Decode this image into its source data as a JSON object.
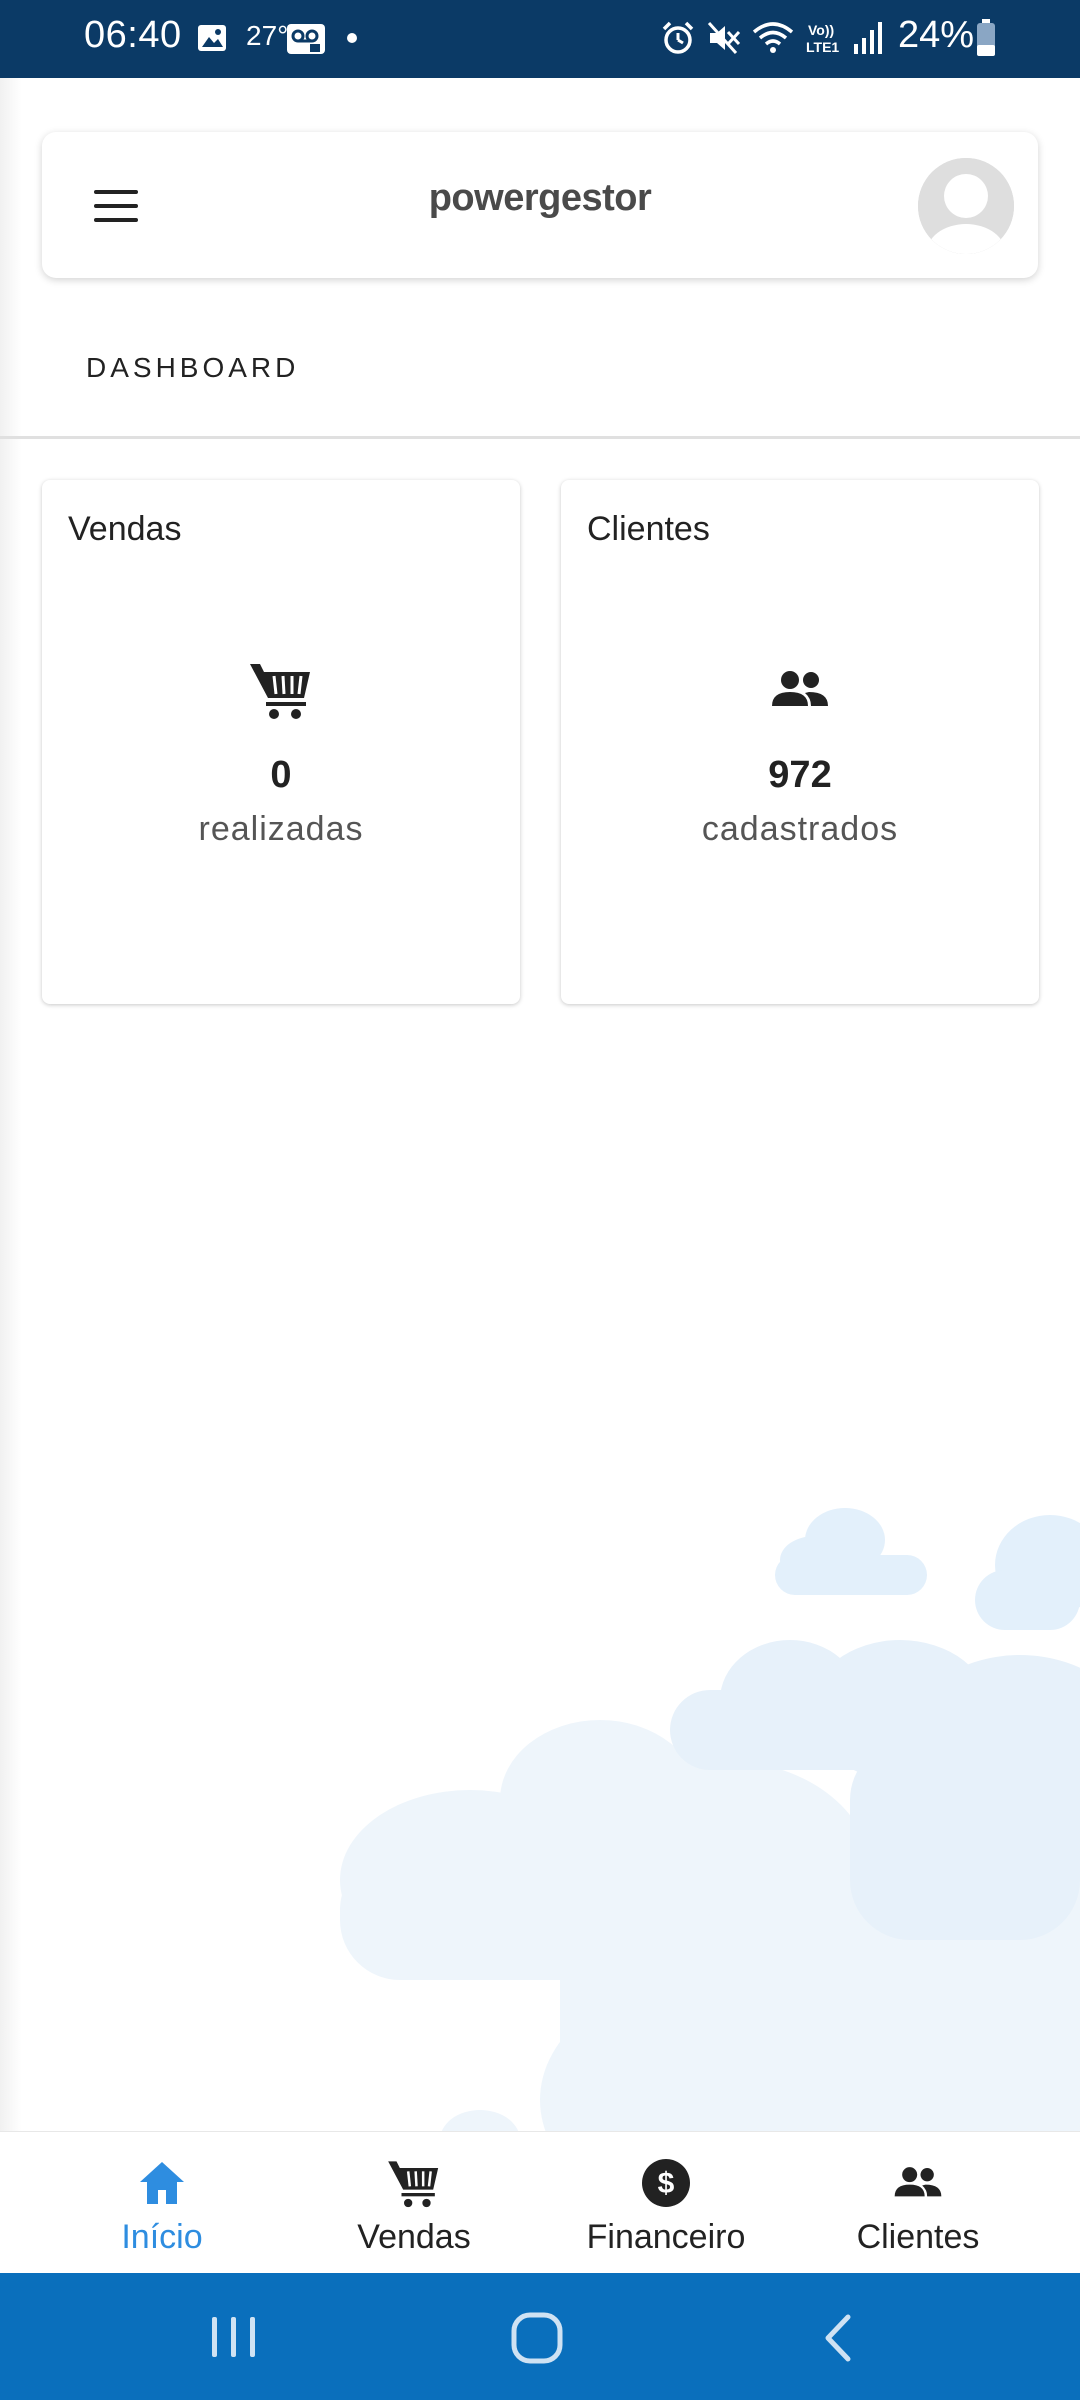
{
  "status_bar": {
    "time": "06:40",
    "temperature": "27°",
    "battery": "24%",
    "icons": [
      "image-icon",
      "voicemail-icon",
      "dot-icon",
      "alarm-icon",
      "mute-icon",
      "wifi-icon",
      "volte-icon",
      "signal-icon",
      "battery-icon"
    ]
  },
  "header": {
    "brand": "powergestor",
    "menu_icon": "hamburger-menu-icon",
    "avatar_icon": "user-avatar-icon"
  },
  "section": {
    "label": "DASHBOARD"
  },
  "cards": [
    {
      "title": "Vendas",
      "icon": "cart-icon",
      "value": "0",
      "caption": "realizadas"
    },
    {
      "title": "Clientes",
      "icon": "people-icon",
      "value": "972",
      "caption": "cadastrados"
    }
  ],
  "bottom_nav": {
    "items": [
      {
        "label": "Início",
        "icon": "home-icon",
        "active": true
      },
      {
        "label": "Vendas",
        "icon": "cart-icon",
        "active": false
      },
      {
        "label": "Financeiro",
        "icon": "dollar-icon",
        "active": false
      },
      {
        "label": "Clientes",
        "icon": "people-icon",
        "active": false
      }
    ]
  },
  "system_nav": {
    "icons": [
      "recents-icon",
      "home-button-icon",
      "back-icon"
    ]
  },
  "colors": {
    "status_bar": "#0b3a66",
    "accent": "#2e8de0",
    "system_nav": "#0a6fbc"
  }
}
